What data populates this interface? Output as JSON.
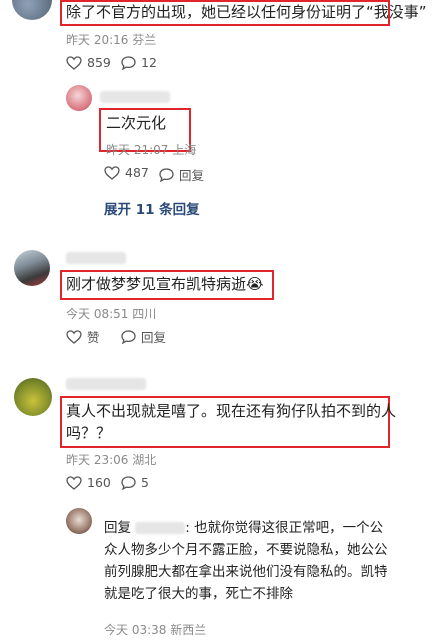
{
  "comments": [
    {
      "text": "除了不官方的出现，她已经以任何身份证明了“我没事”",
      "meta": "昨天 20:16 芬兰",
      "likes": "859",
      "replies": "12"
    },
    {
      "text": "二次元化",
      "meta": "昨天 21:07 上海",
      "likes": "487",
      "reply_label": "回复",
      "expand": "展开 11 条回复"
    },
    {
      "text": "刚才做梦梦见宣布凯特病逝",
      "emoji": "😭",
      "meta": "今天 08:51 四川",
      "likes_label": "赞",
      "reply_label": "回复"
    },
    {
      "text_line1": "真人不出现就是嘻了。现在还有狗仔队拍不到的人",
      "text_line2": "吗？？",
      "meta": "昨天 23:06 湖北",
      "likes": "160",
      "replies": "5"
    },
    {
      "prefix": "回复",
      "lines": [
        ": 也就你觉得这很正常吧，一个公",
        "众人物多少个月不露正脸，不要说隐私，她公公",
        "前列腺肥大都在拿出来说他们没有隐私的。凯特",
        "就是吃了很大的事，死亡不排除"
      ],
      "meta": "今天 03:38 新西兰"
    }
  ],
  "colors": {
    "highlight": "#e0262a",
    "link": "#2a4a7a"
  }
}
